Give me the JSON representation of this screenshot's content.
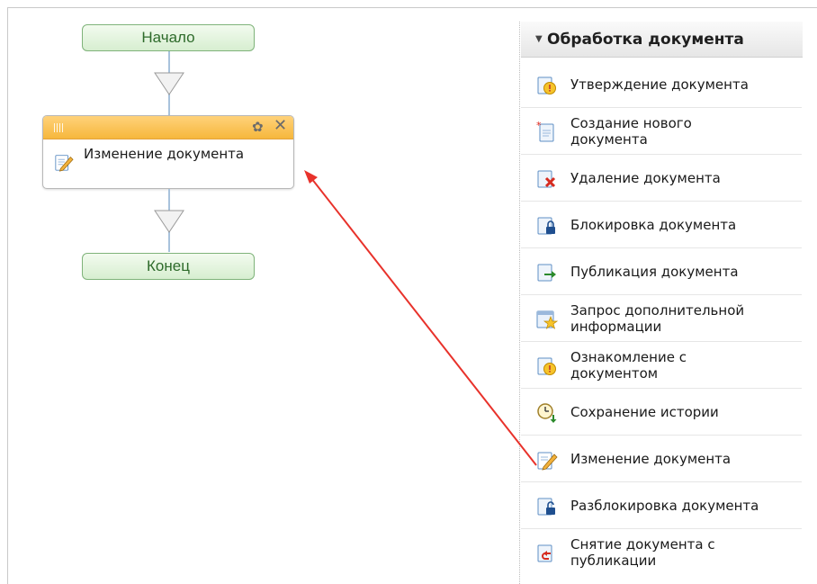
{
  "flow": {
    "start_label": "Начало",
    "end_label": "Конец",
    "step": {
      "label": "Изменение документа",
      "icon": "edit-document-icon"
    }
  },
  "palette": {
    "title": "Обработка документа",
    "items": [
      {
        "label": "Утверждение документа",
        "icon": "approve-document-icon"
      },
      {
        "label": "Создание нового\nдокумента",
        "icon": "new-document-icon"
      },
      {
        "label": "Удаление документа",
        "icon": "delete-document-icon"
      },
      {
        "label": "Блокировка документа",
        "icon": "lock-document-icon"
      },
      {
        "label": "Публикация документа",
        "icon": "publish-document-icon"
      },
      {
        "label": "Запрос дополнительной\nинформации",
        "icon": "request-info-icon"
      },
      {
        "label": "Ознакомление с\nдокументом",
        "icon": "acknowledge-document-icon"
      },
      {
        "label": "Сохранение истории",
        "icon": "save-history-icon"
      },
      {
        "label": "Изменение документа",
        "icon": "edit-document-icon"
      },
      {
        "label": "Разблокировка документа",
        "icon": "unlock-document-icon"
      },
      {
        "label": "Снятие документа с\nпубликации",
        "icon": "unpublish-document-icon"
      }
    ]
  },
  "colors": {
    "drag_arrow": "#e8322b",
    "start_end_fill": "#d7eed0",
    "step_header": "#f6b73c"
  }
}
